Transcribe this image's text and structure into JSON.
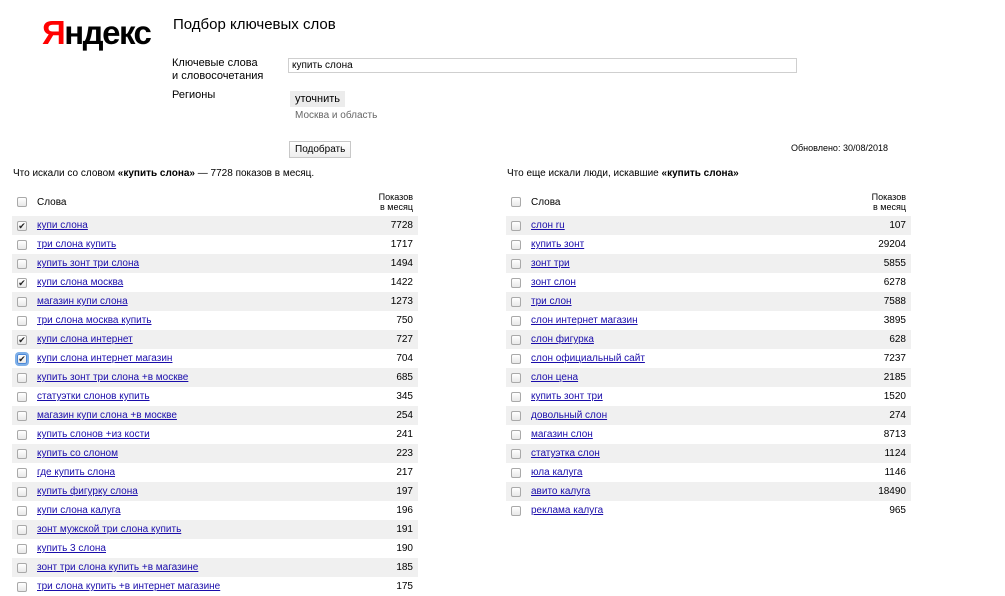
{
  "logo": "Яндекс",
  "title": "Подбор ключевых слов",
  "form": {
    "keywords_label_line1": "Ключевые слова",
    "keywords_label_line2": "и словосочетания",
    "keywords_value": "купить слона",
    "regions_label": "Регионы",
    "clarify_button": "уточнить",
    "region_value": "Москва и область",
    "submit_button": "Подобрать"
  },
  "updated": "Обновлено: 30/08/2018",
  "left": {
    "heading_prefix": "Что искали со словом ",
    "heading_query": "«купить слона»",
    "heading_suffix": " — 7728 показов в месяц.",
    "col_words": "Слова",
    "col_count_line1": "Показов",
    "col_count_line2": "в месяц",
    "rows": [
      {
        "word": "купи слона",
        "count": "7728",
        "checked": true
      },
      {
        "word": "три слона купить",
        "count": "1717",
        "checked": false
      },
      {
        "word": "купить зонт три слона",
        "count": "1494",
        "checked": false
      },
      {
        "word": "купи слона москва",
        "count": "1422",
        "checked": true
      },
      {
        "word": "магазин купи слона",
        "count": "1273",
        "checked": false
      },
      {
        "word": "три слона москва купить",
        "count": "750",
        "checked": false
      },
      {
        "word": "купи слона интернет",
        "count": "727",
        "checked": true
      },
      {
        "word": "купи слона интернет магазин",
        "count": "704",
        "checked": true
      },
      {
        "word": "купить зонт три слона +в москве",
        "count": "685",
        "checked": false
      },
      {
        "word": "статуэтки слонов купить",
        "count": "345",
        "checked": false
      },
      {
        "word": "магазин купи слона +в москве",
        "count": "254",
        "checked": false
      },
      {
        "word": "купить слонов +из кости",
        "count": "241",
        "checked": false
      },
      {
        "word": "купить со слоном",
        "count": "223",
        "checked": false
      },
      {
        "word": "где купить слона",
        "count": "217",
        "checked": false
      },
      {
        "word": "купить фигурку слона",
        "count": "197",
        "checked": false
      },
      {
        "word": "купи слона калуга",
        "count": "196",
        "checked": false
      },
      {
        "word": "зонт мужской три слона купить",
        "count": "191",
        "checked": false
      },
      {
        "word": "купить 3 слона",
        "count": "190",
        "checked": false
      },
      {
        "word": "зонт три слона купить +в магазине",
        "count": "185",
        "checked": false
      },
      {
        "word": "три слона купить +в интернет магазине",
        "count": "175",
        "checked": false
      }
    ]
  },
  "right": {
    "heading_prefix": "Что еще искали люди, искавшие ",
    "heading_query": "«купить слона»",
    "col_words": "Слова",
    "col_count_line1": "Показов",
    "col_count_line2": "в месяц",
    "rows": [
      {
        "word": "слон ru",
        "count": "107",
        "checked": false
      },
      {
        "word": "купить зонт",
        "count": "29204",
        "checked": false
      },
      {
        "word": "зонт три",
        "count": "5855",
        "checked": false
      },
      {
        "word": "зонт слон",
        "count": "6278",
        "checked": false
      },
      {
        "word": "три слон",
        "count": "7588",
        "checked": false
      },
      {
        "word": "слон интернет магазин",
        "count": "3895",
        "checked": false
      },
      {
        "word": "слон фигурка",
        "count": "628",
        "checked": false
      },
      {
        "word": "слон официальный сайт",
        "count": "7237",
        "checked": false
      },
      {
        "word": "слон цена",
        "count": "2185",
        "checked": false
      },
      {
        "word": "купить зонт три",
        "count": "1520",
        "checked": false
      },
      {
        "word": "довольный слон",
        "count": "274",
        "checked": false
      },
      {
        "word": "магазин слон",
        "count": "8713",
        "checked": false
      },
      {
        "word": "статуэтка слон",
        "count": "1124",
        "checked": false
      },
      {
        "word": "юла калуга",
        "count": "1146",
        "checked": false
      },
      {
        "word": "авито калуга",
        "count": "18490",
        "checked": false
      },
      {
        "word": "реклама калуга",
        "count": "965",
        "checked": false
      }
    ]
  }
}
